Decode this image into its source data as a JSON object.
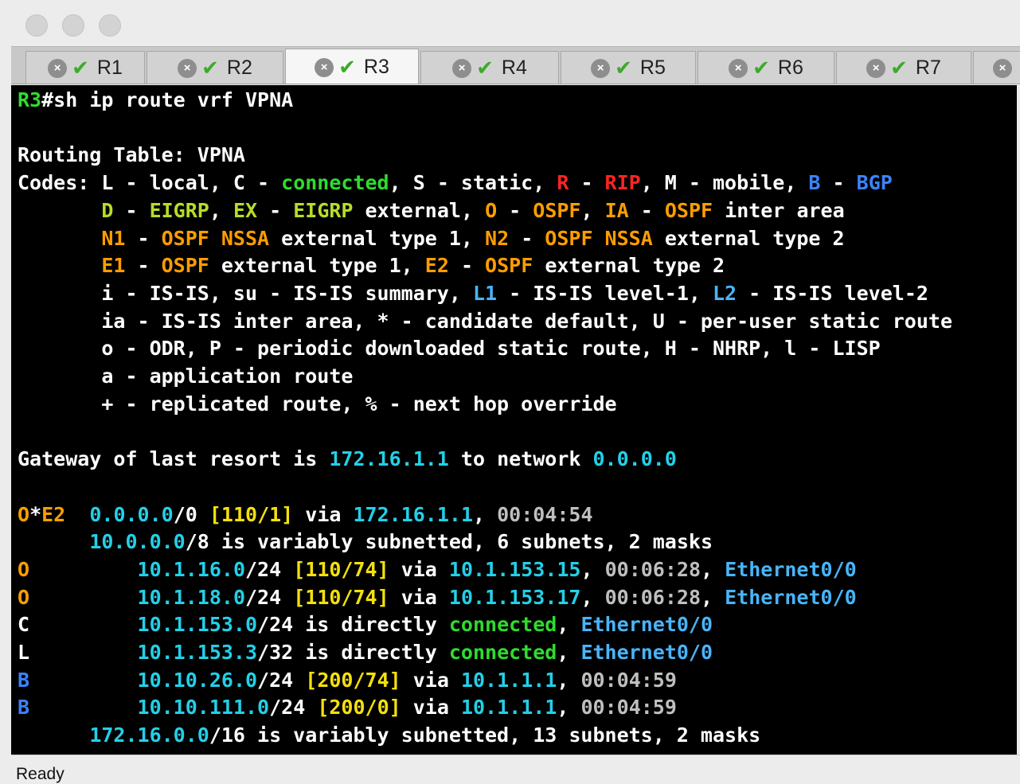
{
  "window": {
    "tabs": [
      "R1",
      "R2",
      "R3",
      "R4",
      "R5",
      "R6",
      "R7"
    ],
    "active_tab": "R3"
  },
  "colors": {
    "default": "#ffffff",
    "green": "#2fdb2f",
    "cyan": "#23d0e8",
    "yellow": "#f4e00c",
    "orange": "#ff9d00",
    "red": "#ff2323",
    "blue": "#3b82ff",
    "lightblue": "#49b4f8",
    "olive": "#b6dd2a",
    "gray": "#bfbfbf"
  },
  "terminal": {
    "lines": [
      [
        [
          "R3",
          "green"
        ],
        [
          "#sh ip route vrf VPNA",
          "default"
        ]
      ],
      [],
      [
        [
          "Routing Table: VPNA",
          "default"
        ]
      ],
      [
        [
          "Codes: L - local, C - ",
          "default"
        ],
        [
          "connected",
          "green"
        ],
        [
          ", S - static, ",
          "default"
        ],
        [
          "R",
          "red"
        ],
        [
          " - ",
          "default"
        ],
        [
          "RIP",
          "red"
        ],
        [
          ", M - mobile, ",
          "default"
        ],
        [
          "B",
          "blue"
        ],
        [
          " - ",
          "default"
        ],
        [
          "BGP",
          "blue"
        ]
      ],
      [
        [
          "       ",
          "default"
        ],
        [
          "D",
          "olive"
        ],
        [
          " - ",
          "default"
        ],
        [
          "EIGRP",
          "olive"
        ],
        [
          ", ",
          "default"
        ],
        [
          "EX",
          "olive"
        ],
        [
          " - ",
          "default"
        ],
        [
          "EIGRP",
          "olive"
        ],
        [
          " external, ",
          "default"
        ],
        [
          "O",
          "orange"
        ],
        [
          " - ",
          "default"
        ],
        [
          "OSPF",
          "orange"
        ],
        [
          ", ",
          "default"
        ],
        [
          "IA",
          "orange"
        ],
        [
          " - ",
          "default"
        ],
        [
          "OSPF",
          "orange"
        ],
        [
          " inter area",
          "default"
        ]
      ],
      [
        [
          "       ",
          "default"
        ],
        [
          "N1",
          "orange"
        ],
        [
          " - ",
          "default"
        ],
        [
          "OSPF NSSA",
          "orange"
        ],
        [
          " external type 1, ",
          "default"
        ],
        [
          "N2",
          "orange"
        ],
        [
          " - ",
          "default"
        ],
        [
          "OSPF NSSA",
          "orange"
        ],
        [
          " external type 2",
          "default"
        ]
      ],
      [
        [
          "       ",
          "default"
        ],
        [
          "E1",
          "orange"
        ],
        [
          " - ",
          "default"
        ],
        [
          "OSPF",
          "orange"
        ],
        [
          " external type 1, ",
          "default"
        ],
        [
          "E2",
          "orange"
        ],
        [
          " - ",
          "default"
        ],
        [
          "OSPF",
          "orange"
        ],
        [
          " external type 2",
          "default"
        ]
      ],
      [
        [
          "       i - IS-IS, su - IS-IS summary, ",
          "default"
        ],
        [
          "L1",
          "lightblue"
        ],
        [
          " - IS-IS level-1, ",
          "default"
        ],
        [
          "L2",
          "lightblue"
        ],
        [
          " - IS-IS level-2",
          "default"
        ]
      ],
      [
        [
          "       ia - IS-IS inter area, * - candidate default, U - per-user static route",
          "default"
        ]
      ],
      [
        [
          "       o - ODR, P - periodic downloaded static route, H - NHRP, l - LISP",
          "default"
        ]
      ],
      [
        [
          "       a - application route",
          "default"
        ]
      ],
      [
        [
          "       + - replicated route, % - next hop override",
          "default"
        ]
      ],
      [],
      [
        [
          "Gateway of last resort is ",
          "default"
        ],
        [
          "172.16.1.1",
          "cyan"
        ],
        [
          " to network ",
          "default"
        ],
        [
          "0.0.0.0",
          "cyan"
        ]
      ],
      [],
      [
        [
          "O",
          "orange"
        ],
        [
          "*",
          "default"
        ],
        [
          "E2",
          "orange"
        ],
        [
          "  ",
          "default"
        ],
        [
          "0.0.0.0",
          "cyan"
        ],
        [
          "/0 ",
          "default"
        ],
        [
          "[110/1]",
          "yellow"
        ],
        [
          " via ",
          "default"
        ],
        [
          "172.16.1.1",
          "cyan"
        ],
        [
          ", ",
          "default"
        ],
        [
          "00:04:54",
          "gray"
        ]
      ],
      [
        [
          "      ",
          "default"
        ],
        [
          "10.0.0.0",
          "cyan"
        ],
        [
          "/8 is variably subnetted, 6 subnets, 2 masks",
          "default"
        ]
      ],
      [
        [
          "O",
          "orange"
        ],
        [
          "         ",
          "default"
        ],
        [
          "10.1.16.0",
          "cyan"
        ],
        [
          "/24 ",
          "default"
        ],
        [
          "[110/74]",
          "yellow"
        ],
        [
          " via ",
          "default"
        ],
        [
          "10.1.153.15",
          "cyan"
        ],
        [
          ", ",
          "default"
        ],
        [
          "00:06:28",
          "gray"
        ],
        [
          ", ",
          "default"
        ],
        [
          "Ethernet0/0",
          "lightblue"
        ]
      ],
      [
        [
          "O",
          "orange"
        ],
        [
          "         ",
          "default"
        ],
        [
          "10.1.18.0",
          "cyan"
        ],
        [
          "/24 ",
          "default"
        ],
        [
          "[110/74]",
          "yellow"
        ],
        [
          " via ",
          "default"
        ],
        [
          "10.1.153.17",
          "cyan"
        ],
        [
          ", ",
          "default"
        ],
        [
          "00:06:28",
          "gray"
        ],
        [
          ", ",
          "default"
        ],
        [
          "Ethernet0/0",
          "lightblue"
        ]
      ],
      [
        [
          "C         ",
          "default"
        ],
        [
          "10.1.153.0",
          "cyan"
        ],
        [
          "/24 is directly ",
          "default"
        ],
        [
          "connected",
          "green"
        ],
        [
          ", ",
          "default"
        ],
        [
          "Ethernet0/0",
          "lightblue"
        ]
      ],
      [
        [
          "L         ",
          "default"
        ],
        [
          "10.1.153.3",
          "cyan"
        ],
        [
          "/32 is directly ",
          "default"
        ],
        [
          "connected",
          "green"
        ],
        [
          ", ",
          "default"
        ],
        [
          "Ethernet0/0",
          "lightblue"
        ]
      ],
      [
        [
          "B",
          "blue"
        ],
        [
          "         ",
          "default"
        ],
        [
          "10.10.26.0",
          "cyan"
        ],
        [
          "/24 ",
          "default"
        ],
        [
          "[200/74]",
          "yellow"
        ],
        [
          " via ",
          "default"
        ],
        [
          "10.1.1.1",
          "cyan"
        ],
        [
          ", ",
          "default"
        ],
        [
          "00:04:59",
          "gray"
        ]
      ],
      [
        [
          "B",
          "blue"
        ],
        [
          "         ",
          "default"
        ],
        [
          "10.10.111.0",
          "cyan"
        ],
        [
          "/24 ",
          "default"
        ],
        [
          "[200/0]",
          "yellow"
        ],
        [
          " via ",
          "default"
        ],
        [
          "10.1.1.1",
          "cyan"
        ],
        [
          ", ",
          "default"
        ],
        [
          "00:04:59",
          "gray"
        ]
      ],
      [
        [
          "      ",
          "default"
        ],
        [
          "172.16.0.0",
          "cyan"
        ],
        [
          "/16 is variably subnetted, 13 subnets, 2 masks",
          "default"
        ]
      ]
    ]
  },
  "status": {
    "text": "Ready"
  }
}
